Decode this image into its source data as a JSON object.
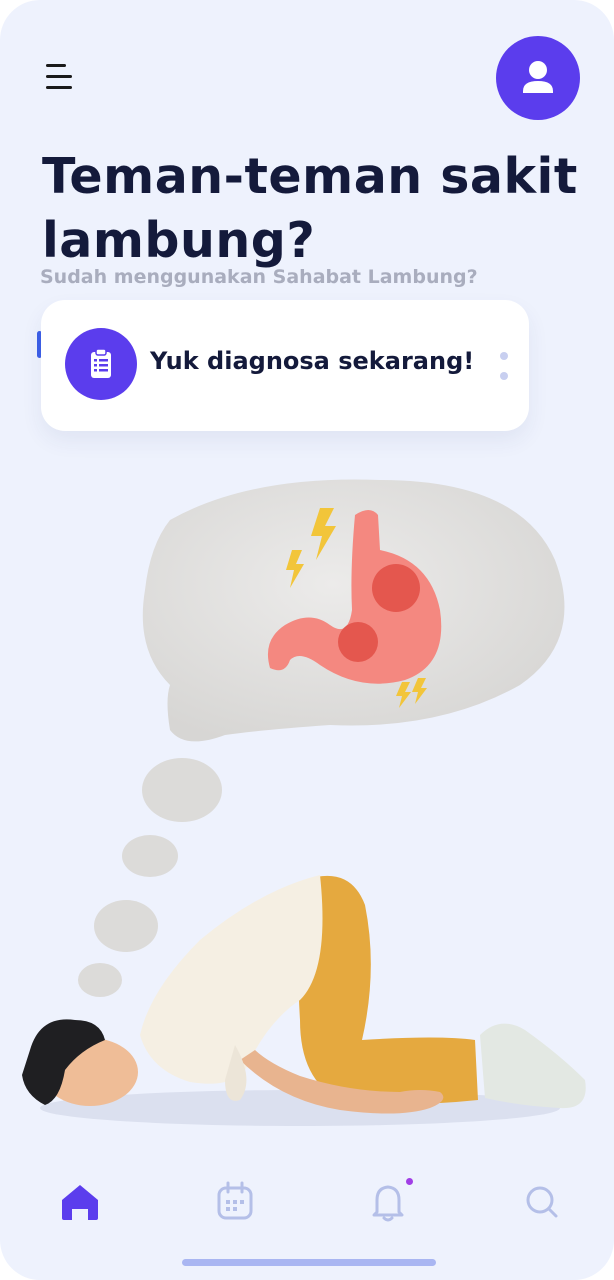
{
  "header": {
    "menu_icon": "menu-icon",
    "profile_icon": "user-icon"
  },
  "hero": {
    "title": "Teman-teman sakit lambung?",
    "subtitle": "Sudah menggunakan Sahabat Lambung?"
  },
  "cta": {
    "icon": "clipboard-icon",
    "label": "Yuk diagnosa sekarang!",
    "more_icon": "more-vertical-icon"
  },
  "illustration": {
    "icon": "stomach-ache-illustration"
  },
  "bottom_nav": {
    "items": [
      {
        "icon": "home-icon",
        "active": true
      },
      {
        "icon": "calendar-icon",
        "active": false
      },
      {
        "icon": "bell-icon",
        "active": false,
        "has_notification": true
      },
      {
        "icon": "search-icon",
        "active": false
      }
    ]
  },
  "colors": {
    "background": "#eef2fd",
    "primary": "#5b3ded",
    "title": "#141a3b",
    "subtitle": "#a9adbe",
    "nav_inactive": "#b4bfe8",
    "notification_dot": "#a13ee6"
  }
}
